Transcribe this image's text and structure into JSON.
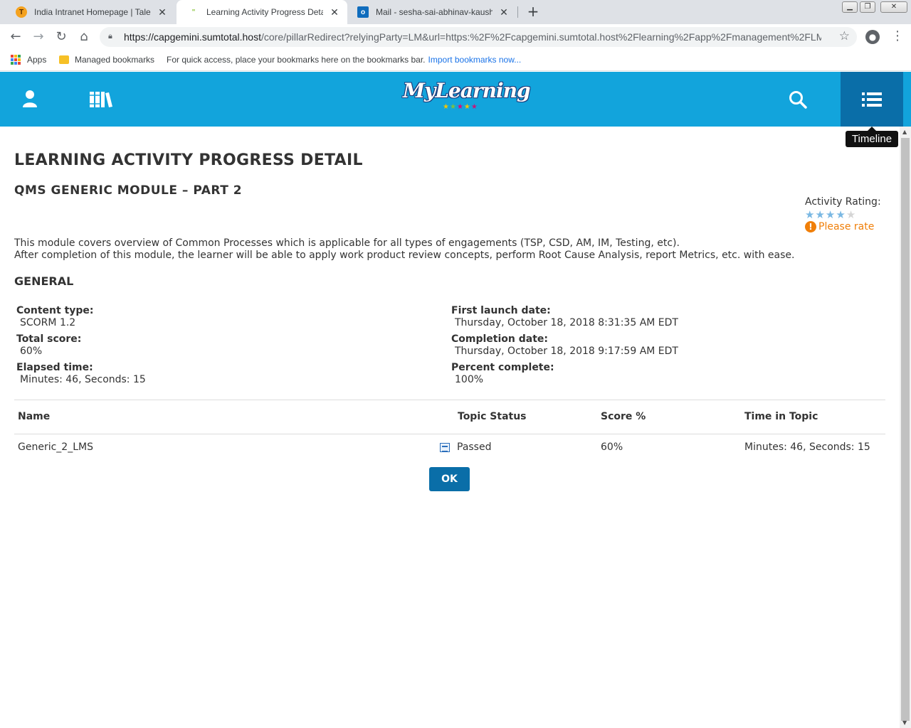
{
  "browser": {
    "tabs": [
      {
        "title": "India Intranet Homepage | Talent",
        "favicon": "talent-favicon",
        "active": false
      },
      {
        "title": "Learning Activity Progress Detail",
        "favicon": "sumtotal-favicon",
        "active": true
      },
      {
        "title": "Mail - sesha-sai-abhinav-kaushal",
        "favicon": "outlook-favicon",
        "active": false
      }
    ],
    "url_host": "https://capgemini.sumtotal.host",
    "url_path": "/core/pillarRedirect?relyingParty=LM&url=https:%2F%2Fcapgemini.sumtotal.host%2Flearning%2Fapp%2Fmanagement%2FLM...",
    "bookmarks": {
      "apps": "Apps",
      "managed": "Managed bookmarks",
      "hint": "For quick access, place your bookmarks here on the bookmarks bar.",
      "import_link": "Import bookmarks now..."
    }
  },
  "header": {
    "logo_text": "MyLearning",
    "accent": "#12a4dc",
    "active_button": "#0a6ea8",
    "tooltip": "Timeline"
  },
  "page": {
    "title": "LEARNING ACTIVITY PROGRESS DETAIL",
    "module_title": "QMS GENERIC MODULE – PART 2",
    "rating": {
      "label": "Activity Rating:",
      "stars": 4,
      "max_stars": 5,
      "prompt": "Please rate"
    },
    "description_line1": "This module covers overview of Common Processes which is applicable for all types of engagements (TSP, CSD, AM, IM, Testing, etc).",
    "description_line2": "After completion of this module, the learner will be able to apply work product review concepts, perform Root Cause Analysis, report Metrics, etc. with ease.",
    "general_heading": "GENERAL",
    "general": {
      "content_type_label": "Content type:",
      "content_type": "SCORM 1.2",
      "total_score_label": "Total score:",
      "total_score": "60%",
      "elapsed_label": "Elapsed time:",
      "elapsed": "Minutes: 46, Seconds: 15",
      "first_launch_label": "First launch date:",
      "first_launch": "Thursday, October 18, 2018 8:31:35 AM EDT",
      "completion_label": "Completion date:",
      "completion": "Thursday, October 18, 2018 9:17:59 AM EDT",
      "percent_label": "Percent complete:",
      "percent": "100%"
    },
    "table": {
      "headers": {
        "name": "Name",
        "status": "Topic Status",
        "score": "Score %",
        "time": "Time in Topic"
      },
      "rows": [
        {
          "name": "Generic_2_LMS",
          "status": "Passed",
          "score": "60%",
          "time": "Minutes: 46, Seconds: 15"
        }
      ]
    },
    "ok_label": "OK"
  }
}
